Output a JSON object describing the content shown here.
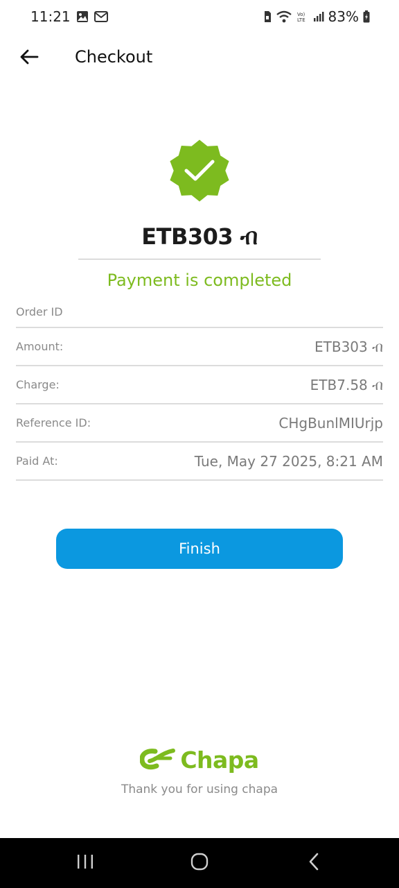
{
  "status_bar": {
    "time": "11:21",
    "battery": "83%",
    "icons": [
      "gallery-icon",
      "gmail-icon",
      "sim-icon",
      "wifi-icon",
      "volte-icon",
      "signal-icon",
      "battery-icon"
    ]
  },
  "app_bar": {
    "title": "Checkout",
    "back_icon": "arrow-left-icon"
  },
  "payment": {
    "amount": "ETB303 ብ",
    "status_text": "Payment is completed",
    "status_color": "#7dbb1f",
    "details": [
      {
        "label": "Order ID",
        "value": ""
      },
      {
        "label": "Amount:",
        "value": "ETB303 ብ"
      },
      {
        "label": "Charge:",
        "value": "ETB7.58 ብ"
      },
      {
        "label": "Reference ID:",
        "value": "CHgBunlMIUrjp"
      },
      {
        "label": "Paid At:",
        "value": "Tue, May 27 2025, 8:21 AM"
      }
    ]
  },
  "finish_button": {
    "label": "Finish",
    "color": "#0b98e0"
  },
  "footer": {
    "brand": "Chapa",
    "thanks": "Thank you for using chapa"
  },
  "nav_bar": {
    "icons": [
      "recent-apps-icon",
      "home-icon",
      "back-icon"
    ]
  }
}
